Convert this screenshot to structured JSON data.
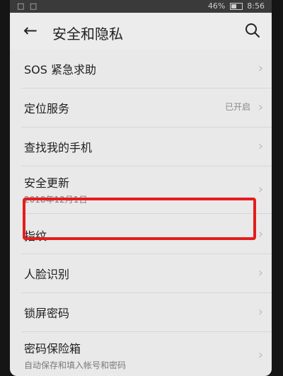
{
  "status": {
    "left": "□ □",
    "battery": "46%",
    "time": "8:56"
  },
  "header": {
    "title": "安全和隐私"
  },
  "items": [
    {
      "label": "SOS 紧急求助"
    },
    {
      "label": "定位服务",
      "value": "已开启"
    },
    {
      "label": "查找我的手机"
    },
    {
      "label": "安全更新",
      "sub": "2018年12月1日"
    },
    {
      "label": "指纹"
    },
    {
      "label": "人脸识别"
    },
    {
      "label": "锁屏密码"
    },
    {
      "label": "密码保险箱",
      "sub": "自动保存和填入帐号和密码"
    }
  ],
  "colors": {
    "highlight": "#e51d1d",
    "background": "#e9e9e9"
  },
  "icons": {
    "back": "arrow-left-icon",
    "search": "search-icon",
    "chevron": "chevron-right-icon"
  }
}
